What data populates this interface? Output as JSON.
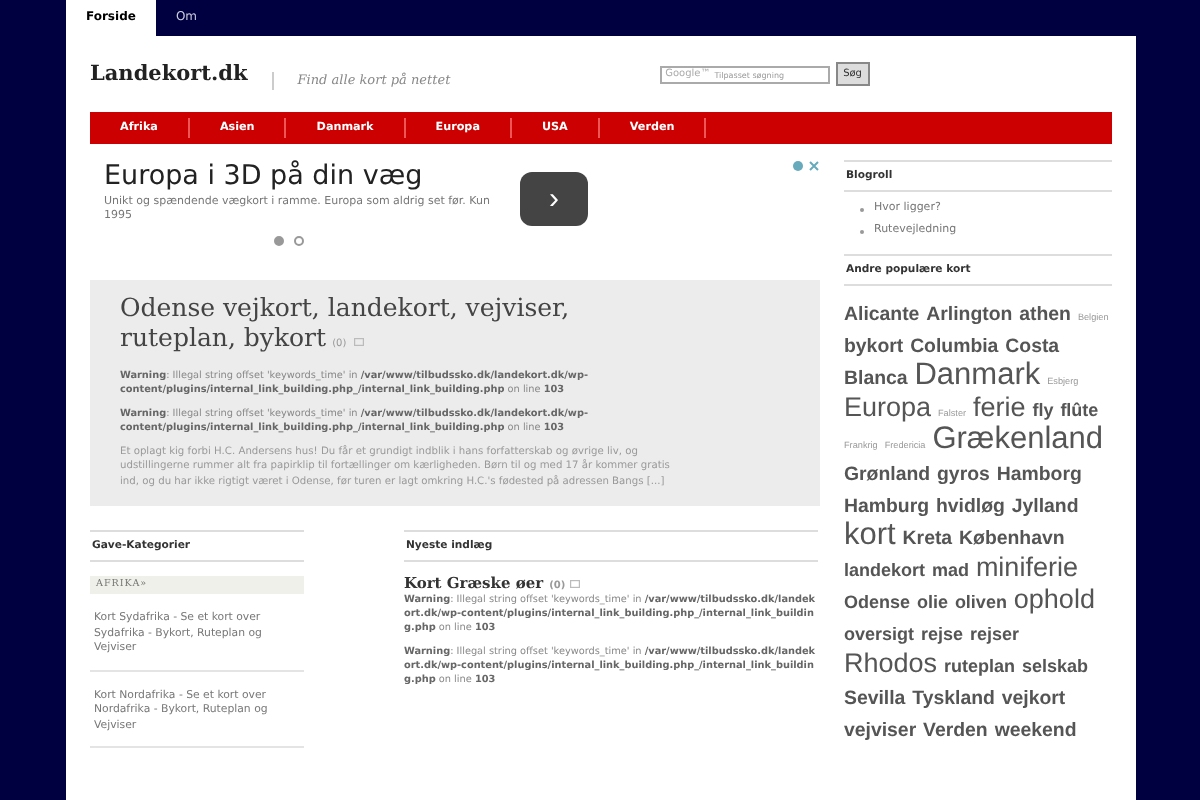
{
  "top_tabs": [
    {
      "label": "Forside",
      "selected": true
    },
    {
      "label": "Om",
      "selected": false
    }
  ],
  "header": {
    "logo": "Landekort.dk",
    "tagline": "Find alle kort på nettet",
    "search": {
      "placeholder": "Tilpasset søgning",
      "brand": "Google™",
      "button": "Søg"
    }
  },
  "nav": [
    "Afrika",
    "Asien",
    "Danmark",
    "Europa",
    "USA",
    "Verden"
  ],
  "ad": {
    "headline": "Europa i 3D på din væg",
    "text": "Unikt og spændende vægkort i ramme. Europa som aldrig set før. Kun 1995",
    "button": "›",
    "dots": [
      {
        "selected": true
      },
      {
        "selected": false
      }
    ]
  },
  "featured": {
    "title": "Odense vejkort, landekort, vejviser, ruteplan, bykort",
    "comments": "(0)",
    "warnings": [
      "**Warning**: Illegal string offset 'keywords_time' in **/var/www/tilbudssko.dk/landekort.dk/wp-content/plugins/internal_link_building.php_/internal_link_building.php** on line **103**",
      "**Warning**: Illegal string offset 'keywords_time' in **/var/www/tilbudssko.dk/landekort.dk/wp-content/plugins/internal_link_building.php_/internal_link_building.php** on line **103**"
    ],
    "excerpt": "Et oplagt kig forbi H.C. Andersens hus! Du får et grundigt indblik i hans forfatterskab og øvrige liv, og udstillingerne rummer alt fra papirklip til fortællinger om kærligheden. Børn til og med 17 år kommer gratis ind, og du har ikke rigtigt været i Odense, før turen er lagt omkring H.C.'s fødested på adressen Bangs [...]"
  },
  "gift_categories": {
    "title": "Gave-Kategorier",
    "category": "AFRIKA»",
    "items": [
      "Kort Sydafrika - Se et kort over Sydafrika - Bykort, Ruteplan og Vejviser",
      "Kort Nordafrika - Se et kort over Nordafrika - Bykort, Ruteplan og Vejviser"
    ]
  },
  "latest": {
    "title": "Nyeste indlæg",
    "post_title": "Kort Græske øer",
    "comments": "(0)",
    "warnings": [
      "**Warning**: Illegal string offset 'keywords_time' in **/var/www/tilbudssko.dk/landekort.dk/wp-content/plugins/internal_link_building.php_/internal_link_building.php** on line **103**",
      "**Warning**: Illegal string offset 'keywords_time' in **/var/www/tilbudssko.dk/landekort.dk/wp-content/plugins/internal_link_building.php_/internal_link_building.php** on line **103**"
    ]
  },
  "blogroll": {
    "title": "Blogroll",
    "items": [
      "Hvor ligger?",
      "Rutevejledning"
    ]
  },
  "tag_cloud": {
    "title": "Andre populære kort",
    "tags": [
      {
        "label": "Alicante",
        "kind": "m"
      },
      {
        "label": "Arlington",
        "kind": "m"
      },
      {
        "label": "athen",
        "kind": "m"
      },
      {
        "label": "Belgien",
        "kind": "xs"
      },
      {
        "label": "bykort",
        "kind": "m"
      },
      {
        "label": "Columbia",
        "kind": "m"
      },
      {
        "label": "Costa",
        "kind": "m"
      },
      {
        "label": "Blanca",
        "kind": "m"
      },
      {
        "label": "Danmark",
        "kind": "xl"
      },
      {
        "label": "Esbjerg",
        "kind": "xs"
      },
      {
        "label": "Europa",
        "kind": "l"
      },
      {
        "label": "Falster",
        "kind": "xs"
      },
      {
        "label": "ferie",
        "kind": "l"
      },
      {
        "label": "fly",
        "kind": "s"
      },
      {
        "label": "flûte",
        "kind": "s"
      },
      {
        "label": "Frankrig",
        "kind": "xs"
      },
      {
        "label": "Fredericia",
        "kind": "xs"
      },
      {
        "label": "Grækenland",
        "kind": "xl"
      },
      {
        "label": "Grønland",
        "kind": "m"
      },
      {
        "label": "gyros",
        "kind": "m"
      },
      {
        "label": "Hamborg",
        "kind": "m"
      },
      {
        "label": "Hamburg",
        "kind": "m"
      },
      {
        "label": "hvidløg",
        "kind": "m"
      },
      {
        "label": "Jylland",
        "kind": "m"
      },
      {
        "label": "kort",
        "kind": "xl"
      },
      {
        "label": "Kreta",
        "kind": "m"
      },
      {
        "label": "København",
        "kind": "m"
      },
      {
        "label": "landekort",
        "kind": "s"
      },
      {
        "label": "mad",
        "kind": "s"
      },
      {
        "label": "miniferie",
        "kind": "l"
      },
      {
        "label": "Odense",
        "kind": "s"
      },
      {
        "label": "olie",
        "kind": "s"
      },
      {
        "label": "oliven",
        "kind": "s"
      },
      {
        "label": "ophold",
        "kind": "l"
      },
      {
        "label": "oversigt",
        "kind": "s"
      },
      {
        "label": "rejse",
        "kind": "s"
      },
      {
        "label": "rejser",
        "kind": "s"
      },
      {
        "label": "Rhodos",
        "kind": "l"
      },
      {
        "label": "ruteplan",
        "kind": "s"
      },
      {
        "label": "selskab",
        "kind": "s"
      },
      {
        "label": "Sevilla",
        "kind": "m"
      },
      {
        "label": "Tyskland",
        "kind": "m"
      },
      {
        "label": "vejkort",
        "kind": "m"
      },
      {
        "label": "vejviser",
        "kind": "m"
      },
      {
        "label": "Verden",
        "kind": "m"
      },
      {
        "label": "weekend",
        "kind": "m"
      }
    ]
  }
}
